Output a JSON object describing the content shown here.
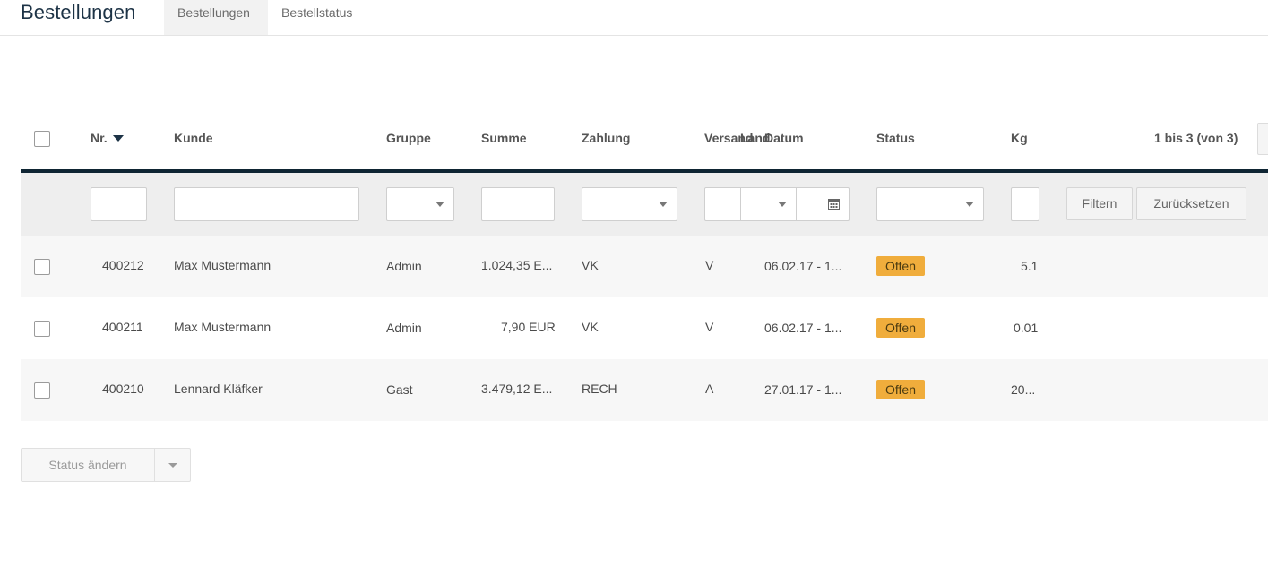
{
  "header": {
    "title": "Bestellungen",
    "tabs": [
      {
        "label": "Bestellungen",
        "active": true
      },
      {
        "label": "Bestellstatus",
        "active": false
      }
    ]
  },
  "table": {
    "columns": {
      "nr": "Nr.",
      "kunde": "Kunde",
      "gruppe": "Gruppe",
      "summe": "Summe",
      "zahlung": "Zahlung",
      "versand": "Versand",
      "land": "Land",
      "datum": "Datum",
      "status": "Status",
      "kg": "Kg"
    },
    "sort_column": "Nr.",
    "sort_direction": "descending",
    "pagination": "1 bis 3 (von 3)",
    "filter": {
      "filter_button": "Filtern",
      "reset_button": "Zurücksetzen"
    },
    "rows": [
      {
        "nr": "400212",
        "kunde": "Max Mustermann",
        "gruppe": "Admin",
        "summe": "1.024,35 E...",
        "zahlung": "VK",
        "versand": "V",
        "datum": "06.02.17 - 1...",
        "status": "Offen",
        "kg": "5.1"
      },
      {
        "nr": "400211",
        "kunde": "Max Mustermann",
        "gruppe": "Admin",
        "summe": "7,90 EUR",
        "zahlung": "VK",
        "versand": "V",
        "datum": "06.02.17 - 1...",
        "status": "Offen",
        "kg": "0.01"
      },
      {
        "nr": "400210",
        "kunde": "Lennard Kläfker",
        "gruppe": "Gast",
        "summe": "3.479,12 E...",
        "zahlung": "RECH",
        "versand": "A",
        "datum": "27.01.17 - 1...",
        "status": "Offen",
        "kg": "20..."
      }
    ]
  },
  "footer": {
    "status_change_button": "Status ändern"
  },
  "colors": {
    "brand_dark": "#1d3346",
    "header_underline": "#0f2533",
    "status_offen": "#f0ad3c"
  }
}
